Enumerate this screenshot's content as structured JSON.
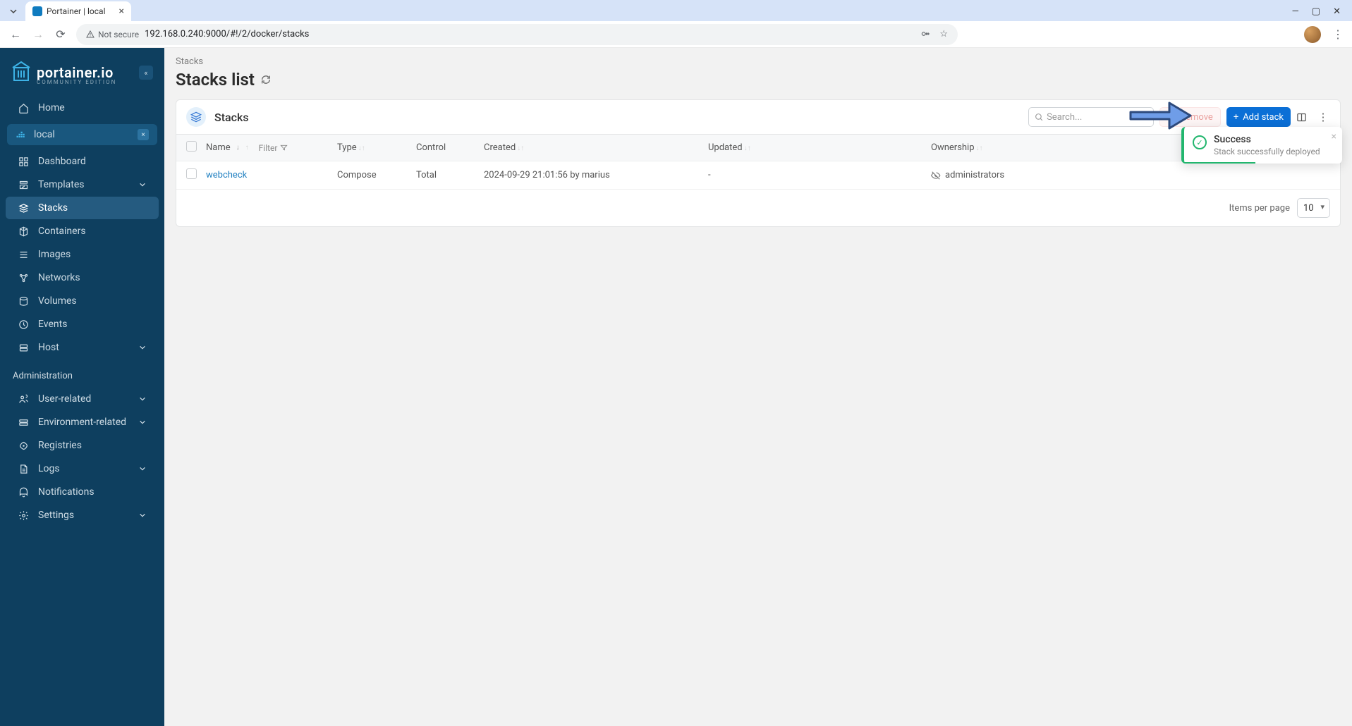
{
  "browser": {
    "tab_title": "Portainer | local",
    "not_secure": "Not secure",
    "url": "192.168.0.240:9000/#!/2/docker/stacks"
  },
  "sidebar": {
    "brand": "portainer.io",
    "brand_sub": "COMMUNITY EDITION",
    "home": "Home",
    "env_name": "local",
    "items": [
      {
        "icon": "dashboard",
        "label": "Dashboard"
      },
      {
        "icon": "templates",
        "label": "Templates",
        "chev": true
      },
      {
        "icon": "stacks",
        "label": "Stacks",
        "active": true
      },
      {
        "icon": "containers",
        "label": "Containers"
      },
      {
        "icon": "images",
        "label": "Images"
      },
      {
        "icon": "networks",
        "label": "Networks"
      },
      {
        "icon": "volumes",
        "label": "Volumes"
      },
      {
        "icon": "events",
        "label": "Events"
      },
      {
        "icon": "host",
        "label": "Host",
        "chev": true
      }
    ],
    "admin_header": "Administration",
    "admin_items": [
      {
        "icon": "users",
        "label": "User-related",
        "chev": true
      },
      {
        "icon": "env",
        "label": "Environment-related",
        "chev": true
      },
      {
        "icon": "registries",
        "label": "Registries"
      },
      {
        "icon": "logs",
        "label": "Logs",
        "chev": true
      },
      {
        "icon": "notifications",
        "label": "Notifications"
      },
      {
        "icon": "settings",
        "label": "Settings",
        "chev": true
      }
    ]
  },
  "page": {
    "breadcrumb": "Stacks",
    "title": "Stacks list",
    "panel_title": "Stacks",
    "search_placeholder": "Search...",
    "remove_label": "Remove",
    "add_label": "Add stack",
    "columns": {
      "name": "Name",
      "filter": "Filter",
      "type": "Type",
      "control": "Control",
      "created": "Created",
      "updated": "Updated",
      "ownership": "Ownership"
    },
    "rows": [
      {
        "name": "webcheck",
        "type": "Compose",
        "control": "Total",
        "created": "2024-09-29 21:01:56 by marius",
        "updated": "-",
        "ownership": "administrators"
      }
    ],
    "items_per_page_label": "Items per page",
    "items_per_page_value": "10"
  },
  "toast": {
    "title": "Success",
    "body": "Stack successfully deployed"
  }
}
